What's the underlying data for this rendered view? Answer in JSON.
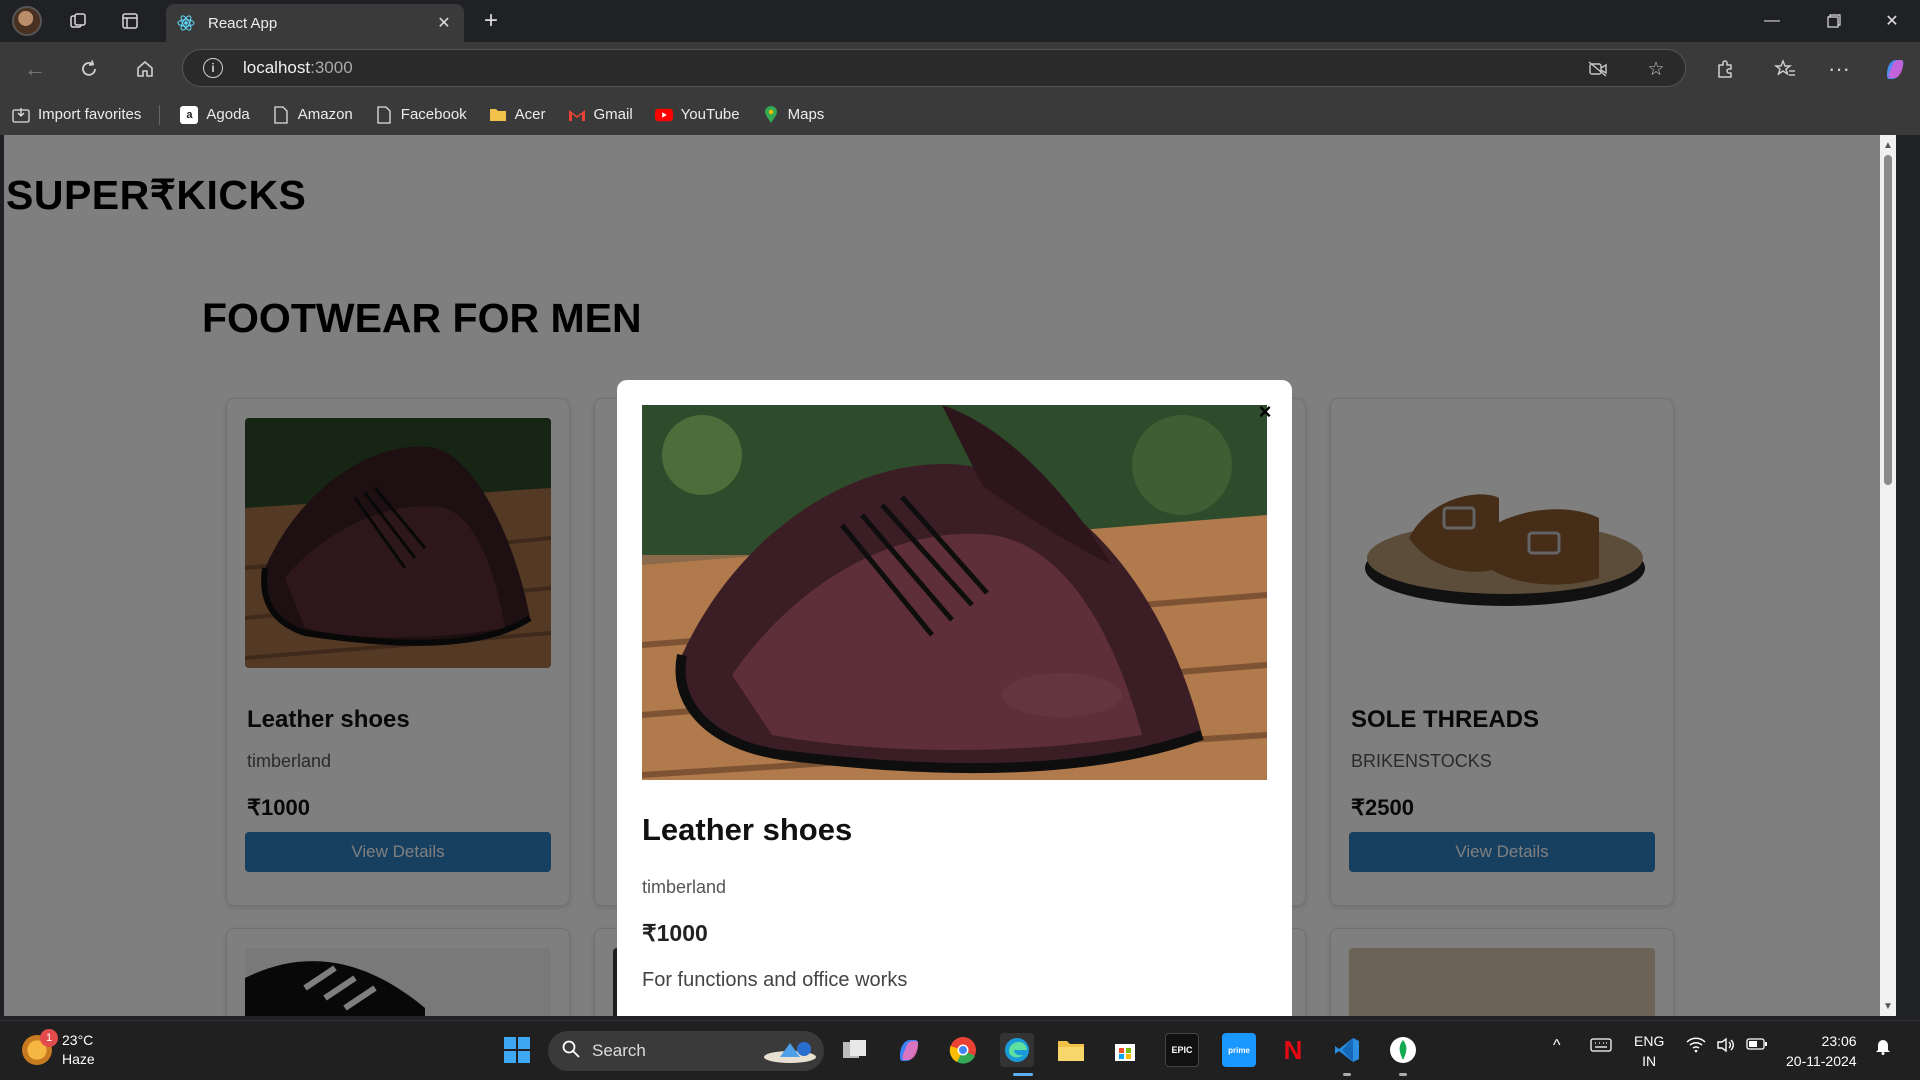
{
  "browser": {
    "tab_title": "React App",
    "url_host": "localhost",
    "url_port": ":3000",
    "window_controls": [
      "minimize",
      "restore",
      "close"
    ]
  },
  "bookmarks": [
    {
      "label": "Import favorites",
      "icon": "import-icon"
    },
    {
      "label": "Agoda",
      "icon": "agoda-icon"
    },
    {
      "label": "Amazon",
      "icon": "page-icon"
    },
    {
      "label": "Facebook",
      "icon": "page-icon"
    },
    {
      "label": "Acer",
      "icon": "folder-icon"
    },
    {
      "label": "Gmail",
      "icon": "gmail-icon"
    },
    {
      "label": "YouTube",
      "icon": "youtube-icon"
    },
    {
      "label": "Maps",
      "icon": "maps-icon"
    }
  ],
  "page": {
    "brand": "SUPER₹KICKS",
    "section_title": "FOOTWEAR FOR MEN",
    "products": [
      {
        "name": "Leather shoes",
        "brand": "timberland",
        "price": "₹1000",
        "button": "View Details"
      },
      {
        "name": "SOLE THREADS",
        "brand": "BRIKENSTOCKS",
        "price": "₹2500",
        "button": "View Details"
      }
    ]
  },
  "modal": {
    "name": "Leather shoes",
    "brand": "timberland",
    "price": "₹1000",
    "description": "For functions and office works",
    "close": "×"
  },
  "taskbar": {
    "weather_temp": "23°C",
    "weather_desc": "Haze",
    "weather_badge": "1",
    "search_label": "Search",
    "lang_1": "ENG",
    "lang_2": "IN",
    "time": "23:06",
    "date": "20-11-2024"
  },
  "colors": {
    "accent_button": "#2f7fc1",
    "overlay": "rgba(0,0,0,0.5)"
  }
}
